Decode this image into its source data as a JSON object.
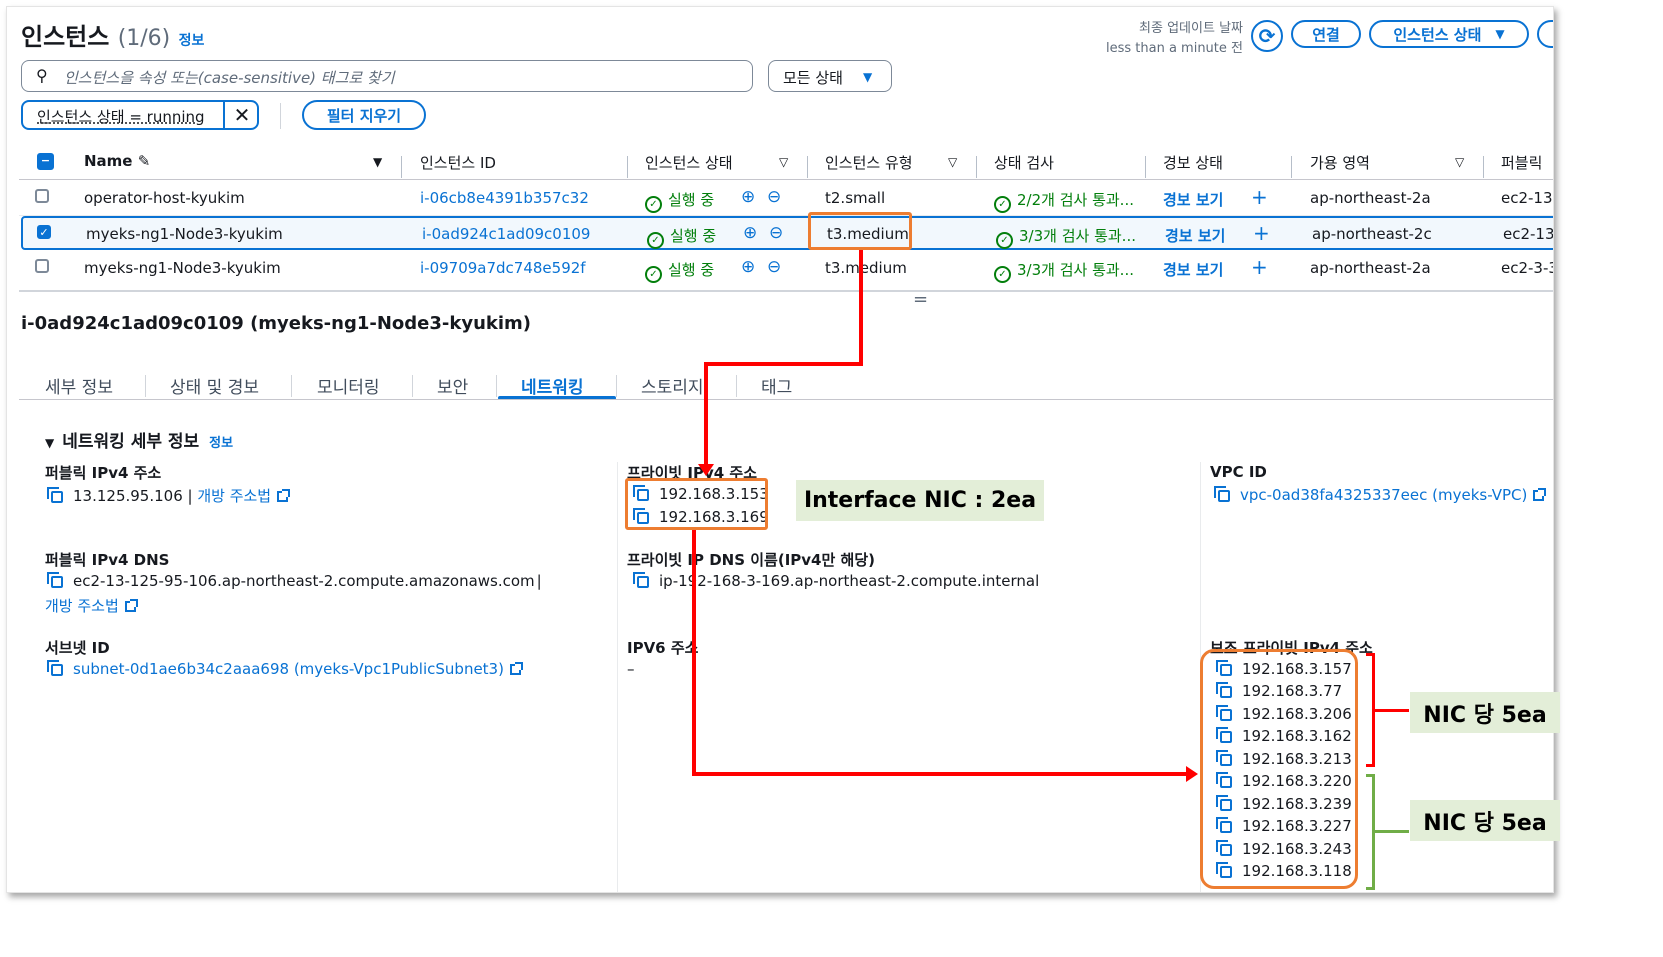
{
  "header": {
    "title": "인스턴스",
    "count": "(1/6)",
    "info": "정보",
    "last_update_label": "최종 업데이트 날짜",
    "last_update_value": "less than a minute 전",
    "connect_label": "연결",
    "instance_state_label": "인스턴스 상태"
  },
  "search": {
    "placeholder": "인스턴스을 속성 또는(case-sensitive) 태그로 찾기"
  },
  "status_filter": {
    "value": "모든 상태"
  },
  "filter_chip": {
    "label": "인스턴스 상태 = running"
  },
  "clear_filter_label": "필터 지우기",
  "table": {
    "columns": [
      "Name",
      "인스턴스 ID",
      "인스턴스 상태",
      "인스턴스 유형",
      "상태 검사",
      "경보 상태",
      "가용 영역",
      "퍼블릭"
    ],
    "rows": [
      {
        "name": "operator-host-kyukim",
        "id": "i-06cb8e4391b357c32",
        "state": "실행 중",
        "type": "t2.small",
        "check": "2/2개 검사 통과...",
        "alarm": "경보 보기",
        "az": "ap-northeast-2a",
        "public": "ec2-13-",
        "selected": false
      },
      {
        "name": "myeks-ng1-Node3-kyukim",
        "id": "i-0ad924c1ad09c0109",
        "state": "실행 중",
        "type": "t3.medium",
        "check": "3/3개 검사 통과...",
        "alarm": "경보 보기",
        "az": "ap-northeast-2c",
        "public": "ec2-13-",
        "selected": true
      },
      {
        "name": "myeks-ng1-Node3-kyukim",
        "id": "i-09709a7dc748e592f",
        "state": "실행 중",
        "type": "t3.medium",
        "check": "3/3개 검사 통과...",
        "alarm": "경보 보기",
        "az": "ap-northeast-2a",
        "public": "ec2-3-3",
        "selected": false
      }
    ]
  },
  "detail": {
    "title": "i-0ad924c1ad09c0109 (myeks-ng1-Node3-kyukim)",
    "tabs": [
      "세부 정보",
      "상태 및 경보",
      "모니터링",
      "보안",
      "네트워킹",
      "스토리지",
      "태그"
    ],
    "active_tab": "네트워킹",
    "section_title": "네트워킹 세부 정보",
    "section_info": "정보",
    "public_ipv4_label": "퍼블릭 IPv4 주소",
    "public_ipv4_value": "13.125.95.106 |",
    "open_address_label": "개방 주소법",
    "public_dns_label": "퍼블릭 IPv4 DNS",
    "public_dns_value": "ec2-13-125-95-106.ap-northeast-2.compute.amazonaws.com",
    "subnet_label": "서브넷 ID",
    "subnet_value": "subnet-0d1ae6b34c2aaa698 (myeks-Vpc1PublicSubnet3)",
    "private_ipv4_label": "프라이빗 IPv4 주소",
    "private_ipv4_values": [
      "192.168.3.153",
      "192.168.3.169"
    ],
    "private_dns_label": "프라이빗 IP DNS 이름(IPv4만 해당)",
    "private_dns_value": "ip-192-168-3-169.ap-northeast-2.compute.internal",
    "ipv6_label": "IPV6 주소",
    "ipv6_value": "–",
    "vpc_label": "VPC ID",
    "vpc_value": "vpc-0ad38fa4325337eec (myeks-VPC)",
    "secondary_label": "보조 프라이빗 IPv4 주소",
    "secondary_ips": [
      "192.168.3.157",
      "192.168.3.77",
      "192.168.3.206",
      "192.168.3.162",
      "192.168.3.213",
      "192.168.3.220",
      "192.168.3.239",
      "192.168.3.227",
      "192.168.3.243",
      "192.168.3.118"
    ]
  },
  "annotations": {
    "interface_nic": "Interface NIC : 2ea",
    "nic_per_1": "NIC 당 5ea",
    "nic_per_2": "NIC 당 5ea"
  },
  "colors": {
    "link": "#0972d3",
    "success": "#037f0c",
    "highlight": "#ed7d31",
    "arrow": "#ff0000",
    "brace_green": "#70ad47"
  }
}
